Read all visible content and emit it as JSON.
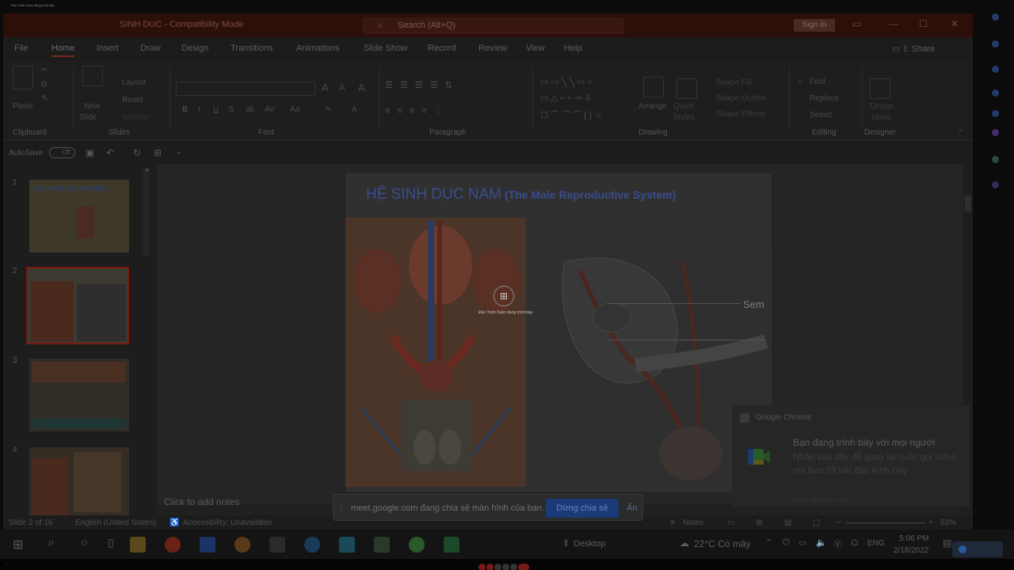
{
  "top_tiny": "Đào Trịnh Xuân đang trình bày",
  "titlebar": {
    "doc_title": "SINH DUC  -  Compatibility Mode",
    "search_placeholder": "Search (Alt+Q)",
    "sign_in": "Sign in"
  },
  "menu": {
    "tabs": [
      "File",
      "Home",
      "Insert",
      "Draw",
      "Design",
      "Transitions",
      "Animations",
      "Slide Show",
      "Record",
      "Review",
      "View",
      "Help"
    ],
    "active": "Home",
    "share": "Share"
  },
  "ribbon": {
    "clipboard": {
      "paste": "Paste",
      "group": "Clipboard"
    },
    "slides": {
      "new_slide": "New",
      "new_slide_2": "Slide",
      "layout": "Layout",
      "reset": "Reset",
      "section": "Section",
      "group": "Slides"
    },
    "font": {
      "group": "Font"
    },
    "paragraph": {
      "group": "Paragraph"
    },
    "drawing": {
      "arrange": "Arrange",
      "quick_styles": "Quick",
      "quick_styles_2": "Styles",
      "shape_fill": "Shape Fill",
      "shape_outline": "Shape Outline",
      "shape_effects": "Shape Effects",
      "group": "Drawing"
    },
    "editing": {
      "find": "Find",
      "replace": "Replace",
      "select": "Select",
      "group": "Editing"
    },
    "designer": {
      "design_ideas": "Design",
      "design_ideas_2": "Ideas",
      "group": "Designer"
    }
  },
  "autosave": {
    "label": "AutoSave",
    "state": "Off"
  },
  "thumbnails": [
    {
      "num": "1",
      "title": "GIẢI PHẪU HỆ SINH DỤC"
    },
    {
      "num": "2",
      "selected": true
    },
    {
      "num": "3"
    },
    {
      "num": "4"
    }
  ],
  "slide": {
    "title_main": "HỆ SINH DỤC NAM",
    "title_sub": "(The Male Reproductive System)",
    "label_sem": "Sem",
    "presenting_caption": "Đào Trịnh Xuân đang trình bày"
  },
  "notes_placeholder": "Click to add notes",
  "statusbar": {
    "slide_count": "Slide 2 of 16",
    "language": "English (United States)",
    "accessibility": "Accessibility: Unavailable",
    "notes": "Notes",
    "zoom": "63%"
  },
  "sharebar": {
    "message": "meet.google.com đang chia sẻ màn hình của bạn.",
    "stop": "Dừng chia sẻ",
    "hide": "Ẩn"
  },
  "notification": {
    "app": "Google Chrome",
    "title": "Bạn đang trình bày với mọi người",
    "body": "Nhấp vào đây để quay lại cuộc gọi video mà bạn đã bắt đầu trình bày",
    "meta": "meet.google.com"
  },
  "taskbar": {
    "desktop": "Desktop",
    "weather": "22°C  Có mây",
    "lang": "ENG",
    "time": "5:06 PM",
    "date": "2/18/2022"
  },
  "colors": {
    "accent": "#7a1a0f",
    "slide_title": "#3a4d8e",
    "share_button": "#1a3a78"
  }
}
